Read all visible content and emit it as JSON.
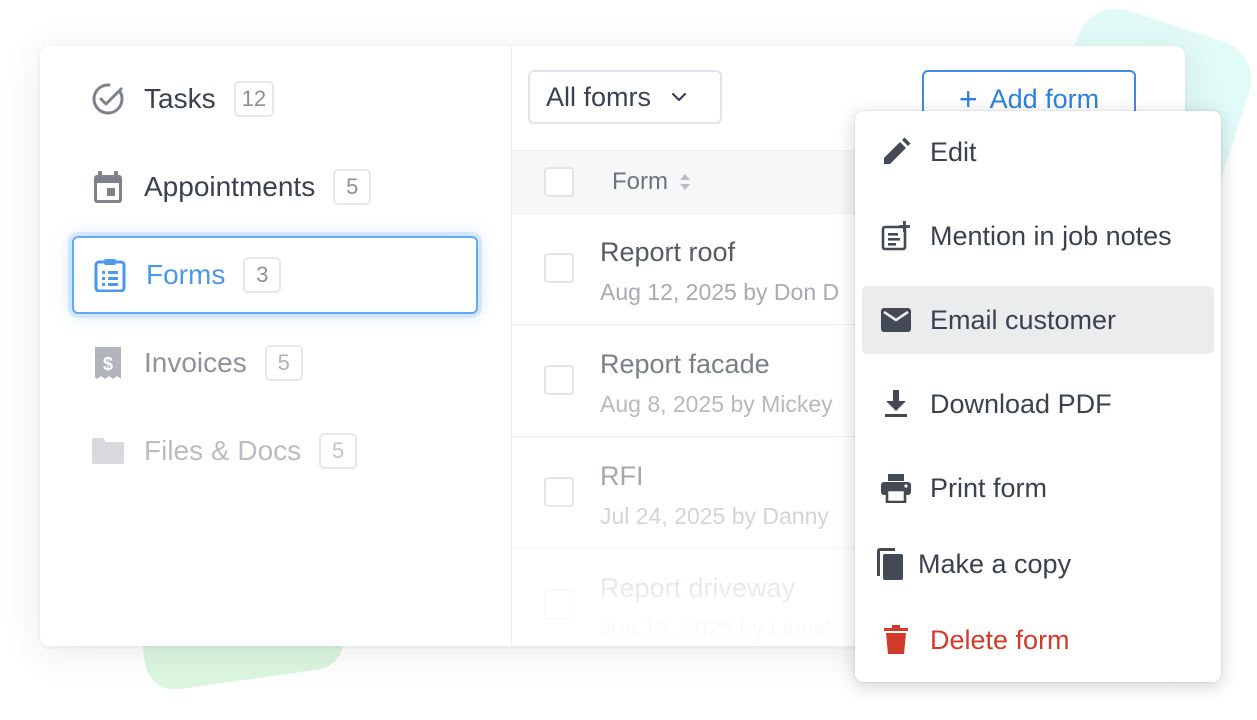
{
  "colors": {
    "accent": "#3d8be6",
    "active_label": "#4a9ae8",
    "danger": "#d33a2c",
    "text": "#3b4150",
    "muted": "#a6aab2"
  },
  "sidebar": {
    "items": [
      {
        "label": "Tasks",
        "count": "12",
        "icon": "check-circle-icon",
        "state": "normal"
      },
      {
        "label": "Appointments",
        "count": "5",
        "icon": "calendar-icon",
        "state": "normal"
      },
      {
        "label": "Forms",
        "count": "3",
        "icon": "clipboard-list-icon",
        "state": "active"
      },
      {
        "label": "Invoices",
        "count": "5",
        "icon": "receipt-dollar-icon",
        "state": "faded"
      },
      {
        "label": "Files & Docs",
        "count": "5",
        "icon": "folder-icon",
        "state": "faded"
      }
    ]
  },
  "toolbar": {
    "filter_label": "All fomrs",
    "add_label": "Add form"
  },
  "table": {
    "column_header": "Form",
    "rows": [
      {
        "title": "Report roof",
        "meta": "Aug 12, 2025 by Don D"
      },
      {
        "title": "Report facade",
        "meta": "Aug 8, 2025 by Mickey"
      },
      {
        "title": "RFI",
        "meta": "Jul 24, 2025 by Danny"
      },
      {
        "title": "Report driveway",
        "meta": "Jun 18, 2025 by Lionel"
      }
    ]
  },
  "context_menu": {
    "items": [
      {
        "label": "Edit",
        "icon": "pencil-icon"
      },
      {
        "label": "Mention in job notes",
        "icon": "note-add-icon"
      },
      {
        "label": "Email customer",
        "icon": "envelope-icon",
        "highlighted": true
      },
      {
        "label": "Download PDF",
        "icon": "download-icon"
      },
      {
        "label": "Print form",
        "icon": "printer-icon"
      },
      {
        "label": "Make a copy",
        "icon": "copy-icon"
      },
      {
        "label": "Delete form",
        "icon": "trash-icon",
        "danger": true
      }
    ]
  }
}
